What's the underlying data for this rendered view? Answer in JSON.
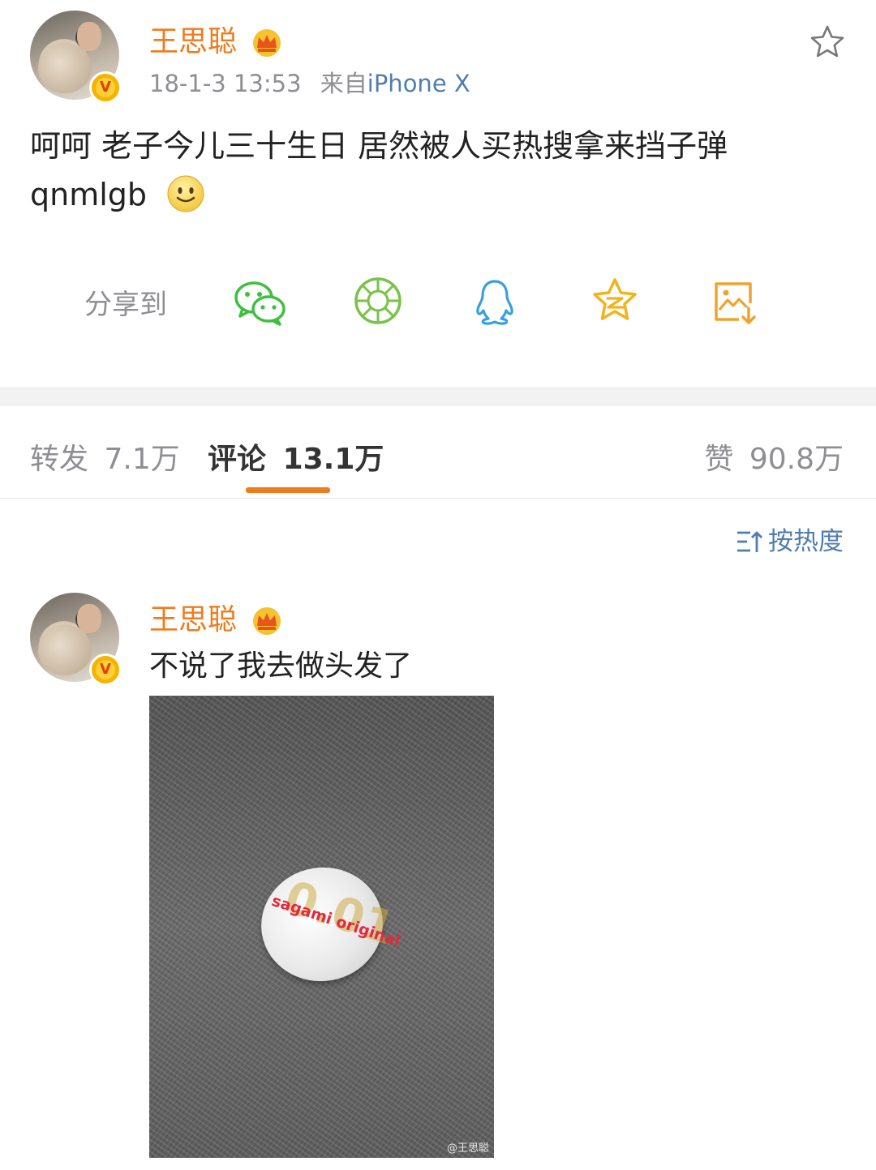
{
  "post": {
    "author": "王思聪",
    "timestamp": "18-1-3 13:53",
    "source_prefix": "来自",
    "source": "iPhone X",
    "text_line1": "呵呵 老子今儿三十生日 居然被人买热搜拿来挡子弹",
    "text_line2": "qnmlgb",
    "emoji_icon": "smile-emoji-icon"
  },
  "share": {
    "label": "分享到",
    "targets": [
      "wechat-icon",
      "moments-icon",
      "qq-icon",
      "qzone-icon",
      "save-image-icon"
    ]
  },
  "tabs": {
    "reposts": {
      "label": "转发",
      "count": "7.1万"
    },
    "comments": {
      "label": "评论",
      "count": "13.1万"
    },
    "likes": {
      "label": "赞",
      "count": "90.8万"
    }
  },
  "sort": {
    "label": "按热度"
  },
  "comment": {
    "author": "王思聪",
    "text": "不说了我去做头发了",
    "photo_product_text": "sagami original",
    "photo_product_number": "0.01",
    "photo_watermark": "@王思聪"
  },
  "colors": {
    "username": "#f07b1c",
    "link": "#507daf",
    "accent_underline": "#f07b1c",
    "wechat": "#3fbf3f",
    "moments": "#7bc14a",
    "qq": "#3a9fe0",
    "qzone": "#f2b31c",
    "save": "#f0a32c"
  }
}
